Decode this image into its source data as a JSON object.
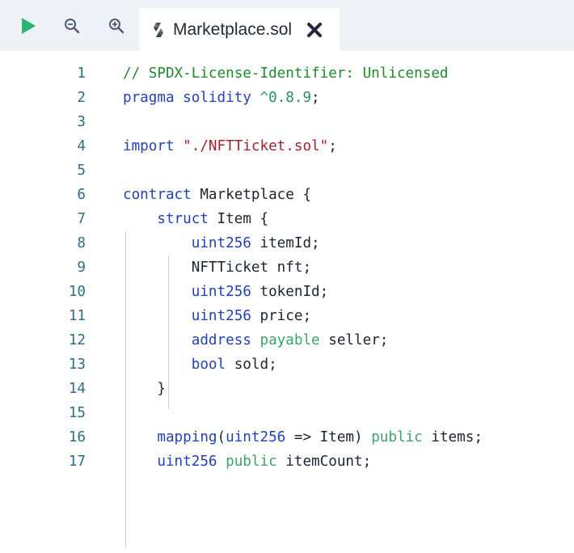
{
  "toolbar": {
    "run_icon": "play-icon",
    "zoom_out_icon": "zoom-out-icon",
    "zoom_in_icon": "zoom-in-icon",
    "accent_run": "#2bb673"
  },
  "tab": {
    "icon": "solidity-file-icon",
    "label": "Marketplace.sol",
    "close_icon": "close-icon"
  },
  "editor": {
    "lines": [
      {
        "n": "1",
        "tokens": [
          {
            "t": "// SPDX-License-Identifier: Unlicensed",
            "c": "comment"
          }
        ]
      },
      {
        "n": "2",
        "tokens": [
          {
            "t": "pragma solidity ",
            "c": "kw"
          },
          {
            "t": "^0.8.9",
            "c": "num"
          },
          {
            "t": ";",
            "c": "plain"
          }
        ]
      },
      {
        "n": "3",
        "tokens": []
      },
      {
        "n": "4",
        "tokens": [
          {
            "t": "import ",
            "c": "kw"
          },
          {
            "t": "\"./NFTTicket.sol\"",
            "c": "str"
          },
          {
            "t": ";",
            "c": "plain"
          }
        ]
      },
      {
        "n": "5",
        "tokens": []
      },
      {
        "n": "6",
        "tokens": [
          {
            "t": "contract ",
            "c": "kw"
          },
          {
            "t": "Marketplace {",
            "c": "plain"
          }
        ]
      },
      {
        "n": "7",
        "tokens": [
          {
            "t": "    struct ",
            "c": "kw"
          },
          {
            "t": "Item {",
            "c": "plain"
          }
        ]
      },
      {
        "n": "8",
        "tokens": [
          {
            "t": "        uint256 ",
            "c": "kw"
          },
          {
            "t": "itemId;",
            "c": "plain"
          }
        ]
      },
      {
        "n": "9",
        "tokens": [
          {
            "t": "        NFTTicket nft;",
            "c": "plain"
          }
        ]
      },
      {
        "n": "10",
        "tokens": [
          {
            "t": "        uint256 ",
            "c": "kw"
          },
          {
            "t": "tokenId;",
            "c": "plain"
          }
        ]
      },
      {
        "n": "11",
        "tokens": [
          {
            "t": "        uint256 ",
            "c": "kw"
          },
          {
            "t": "price;",
            "c": "plain"
          }
        ]
      },
      {
        "n": "12",
        "tokens": [
          {
            "t": "        address ",
            "c": "kw"
          },
          {
            "t": "payable ",
            "c": "mod"
          },
          {
            "t": "seller;",
            "c": "plain"
          }
        ]
      },
      {
        "n": "13",
        "tokens": [
          {
            "t": "        bool ",
            "c": "kw"
          },
          {
            "t": "sold;",
            "c": "plain"
          }
        ]
      },
      {
        "n": "14",
        "tokens": [
          {
            "t": "    }",
            "c": "plain"
          }
        ]
      },
      {
        "n": "15",
        "tokens": []
      },
      {
        "n": "16",
        "tokens": [
          {
            "t": "    mapping",
            "c": "kw"
          },
          {
            "t": "(",
            "c": "plain"
          },
          {
            "t": "uint256",
            "c": "kw"
          },
          {
            "t": " => Item) ",
            "c": "plain"
          },
          {
            "t": "public ",
            "c": "mod"
          },
          {
            "t": "items;",
            "c": "plain"
          }
        ]
      },
      {
        "n": "17",
        "tokens": [
          {
            "t": "    uint256 ",
            "c": "kw"
          },
          {
            "t": "public ",
            "c": "mod"
          },
          {
            "t": "itemCount;",
            "c": "plain"
          }
        ]
      }
    ]
  }
}
